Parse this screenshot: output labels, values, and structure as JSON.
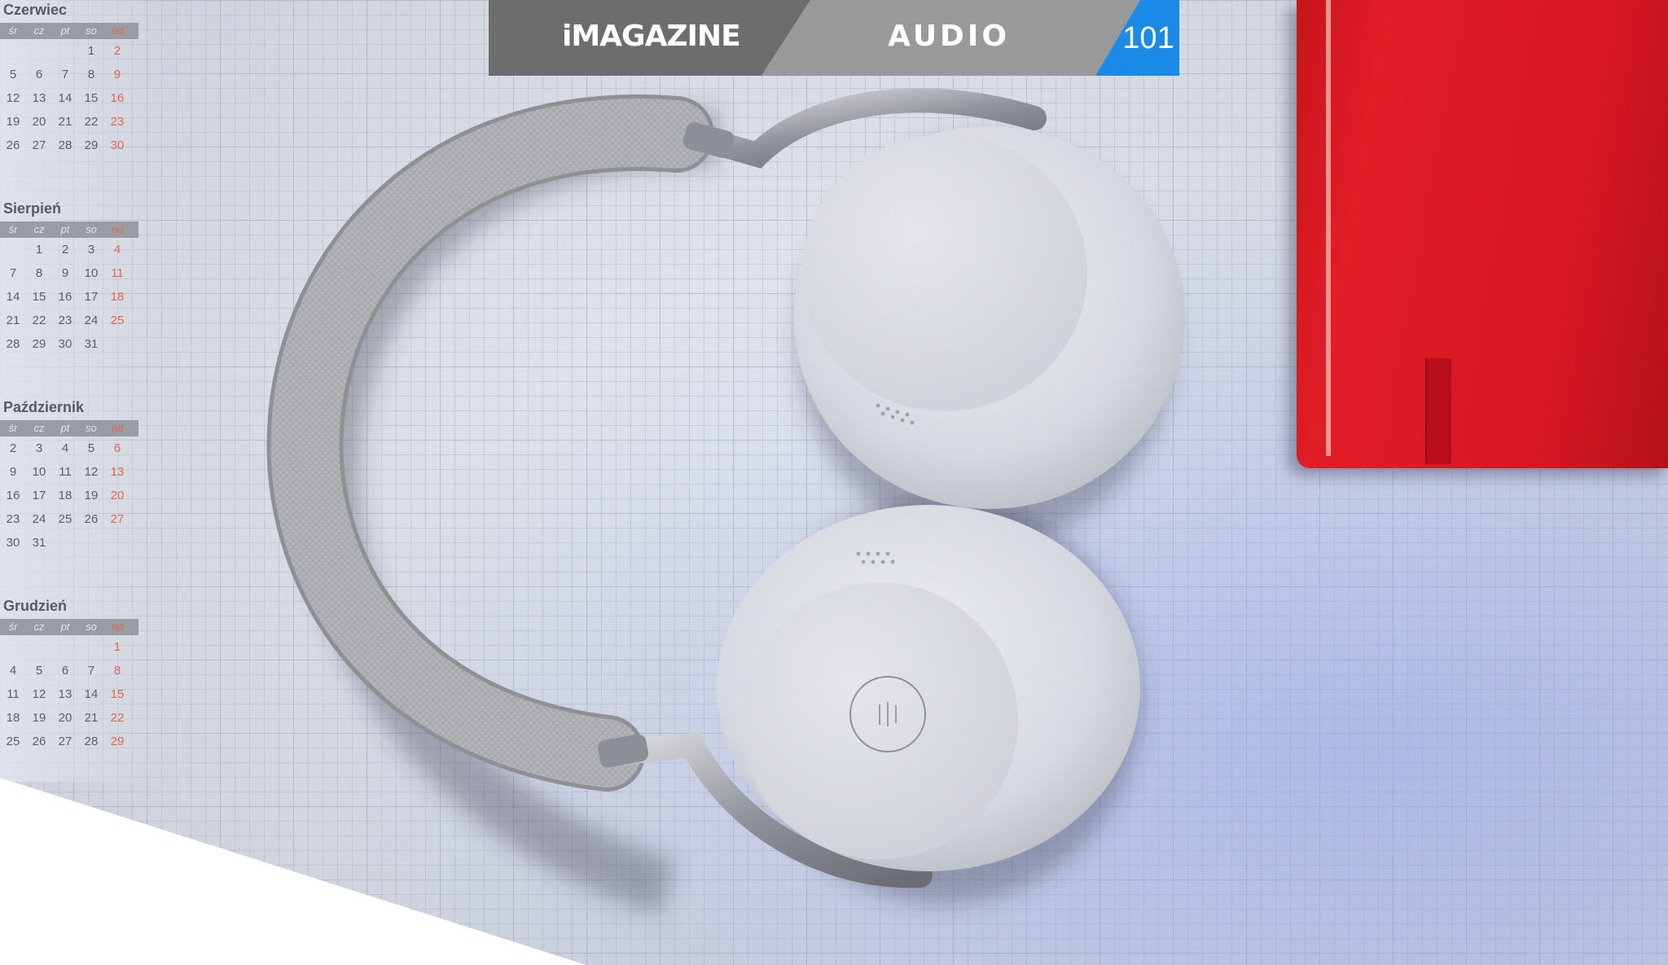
{
  "header": {
    "logo": "iMAGAZINE",
    "section": "AUDIO",
    "page_number": "101"
  },
  "colors": {
    "header_dark": "#6d6d6d",
    "header_light": "#999999",
    "page_tab_blue": "#1b8ae6",
    "notebook_red": "#dd1a23"
  },
  "calendar": {
    "day_headers": [
      "śr",
      "cz",
      "pt",
      "so",
      "nd"
    ],
    "months": [
      {
        "name": "Czerwiec",
        "weeks": [
          [
            "",
            "",
            "",
            "1",
            "2"
          ],
          [
            "5",
            "6",
            "7",
            "8",
            "9"
          ],
          [
            "12",
            "13",
            "14",
            "15",
            "16"
          ],
          [
            "19",
            "20",
            "21",
            "22",
            "23"
          ],
          [
            "26",
            "27",
            "28",
            "29",
            "30"
          ]
        ]
      },
      {
        "name": "Sierpień",
        "weeks": [
          [
            "",
            "1",
            "2",
            "3",
            "4"
          ],
          [
            "7",
            "8",
            "9",
            "10",
            "11"
          ],
          [
            "14",
            "15",
            "16",
            "17",
            "18"
          ],
          [
            "21",
            "22",
            "23",
            "24",
            "25"
          ],
          [
            "28",
            "29",
            "30",
            "31",
            ""
          ]
        ]
      },
      {
        "name": "Październik",
        "weeks": [
          [
            "2",
            "3",
            "4",
            "5",
            "6"
          ],
          [
            "9",
            "10",
            "11",
            "12",
            "13"
          ],
          [
            "16",
            "17",
            "18",
            "19",
            "20"
          ],
          [
            "23",
            "24",
            "25",
            "26",
            "27"
          ],
          [
            "30",
            "31",
            "",
            "",
            ""
          ]
        ]
      },
      {
        "name": "Grudzień",
        "weeks": [
          [
            "",
            "",
            "",
            "",
            "1"
          ],
          [
            "4",
            "5",
            "6",
            "7",
            "8"
          ],
          [
            "11",
            "12",
            "13",
            "14",
            "15"
          ],
          [
            "18",
            "19",
            "20",
            "21",
            "22"
          ],
          [
            "25",
            "26",
            "27",
            "28",
            "29"
          ]
        ]
      }
    ]
  }
}
